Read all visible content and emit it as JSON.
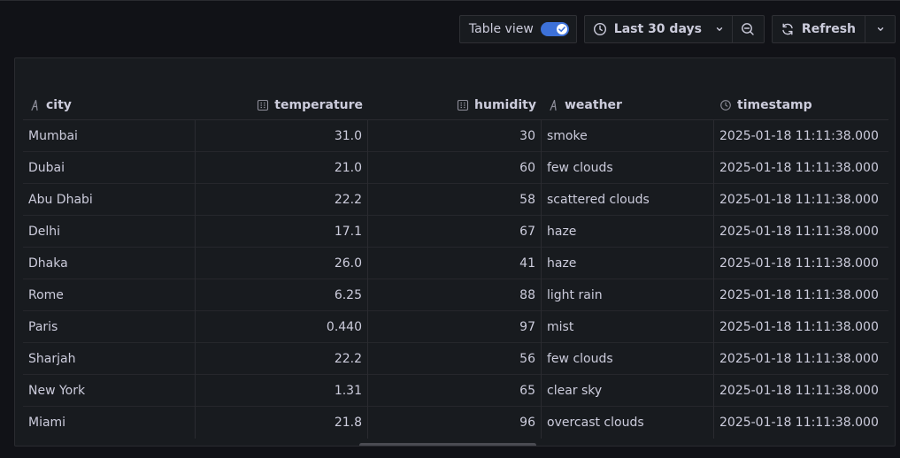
{
  "toolbar": {
    "table_view_label": "Table view",
    "table_view_on": true,
    "time_range_label": "Last 30 days",
    "refresh_label": "Refresh"
  },
  "icons": {
    "clock": "clock-icon",
    "chevron": "chevron-down-icon",
    "zoom_out": "zoom-out-icon",
    "refresh": "refresh-icon",
    "string_type": "string-type-icon",
    "number_type": "number-type-icon",
    "time_type": "time-type-icon"
  },
  "colors": {
    "accent": "#3d71d9",
    "background": "#111217",
    "panel": "#181b1f",
    "text": "#ccccdc"
  },
  "table": {
    "columns": [
      {
        "key": "city",
        "label": "city",
        "type": "string",
        "align": "left"
      },
      {
        "key": "temperature",
        "label": "temperature",
        "type": "number",
        "align": "right"
      },
      {
        "key": "humidity",
        "label": "humidity",
        "type": "number",
        "align": "right"
      },
      {
        "key": "weather",
        "label": "weather",
        "type": "string",
        "align": "left"
      },
      {
        "key": "timestamp",
        "label": "timestamp",
        "type": "time",
        "align": "left"
      }
    ],
    "rows": [
      {
        "city": "Mumbai",
        "temperature": "31.0",
        "humidity": "30",
        "weather": "smoke",
        "timestamp": "2025-01-18 11:11:38.000"
      },
      {
        "city": "Dubai",
        "temperature": "21.0",
        "humidity": "60",
        "weather": "few clouds",
        "timestamp": "2025-01-18 11:11:38.000"
      },
      {
        "city": "Abu Dhabi",
        "temperature": "22.2",
        "humidity": "58",
        "weather": "scattered clouds",
        "timestamp": "2025-01-18 11:11:38.000"
      },
      {
        "city": "Delhi",
        "temperature": "17.1",
        "humidity": "67",
        "weather": "haze",
        "timestamp": "2025-01-18 11:11:38.000"
      },
      {
        "city": "Dhaka",
        "temperature": "26.0",
        "humidity": "41",
        "weather": "haze",
        "timestamp": "2025-01-18 11:11:38.000"
      },
      {
        "city": "Rome",
        "temperature": "6.25",
        "humidity": "88",
        "weather": "light rain",
        "timestamp": "2025-01-18 11:11:38.000"
      },
      {
        "city": "Paris",
        "temperature": "0.440",
        "humidity": "97",
        "weather": "mist",
        "timestamp": "2025-01-18 11:11:38.000"
      },
      {
        "city": "Sharjah",
        "temperature": "22.2",
        "humidity": "56",
        "weather": "few clouds",
        "timestamp": "2025-01-18 11:11:38.000"
      },
      {
        "city": "New York",
        "temperature": "1.31",
        "humidity": "65",
        "weather": "clear sky",
        "timestamp": "2025-01-18 11:11:38.000"
      },
      {
        "city": "Miami",
        "temperature": "21.8",
        "humidity": "96",
        "weather": "overcast clouds",
        "timestamp": "2025-01-18 11:11:38.000"
      }
    ]
  }
}
